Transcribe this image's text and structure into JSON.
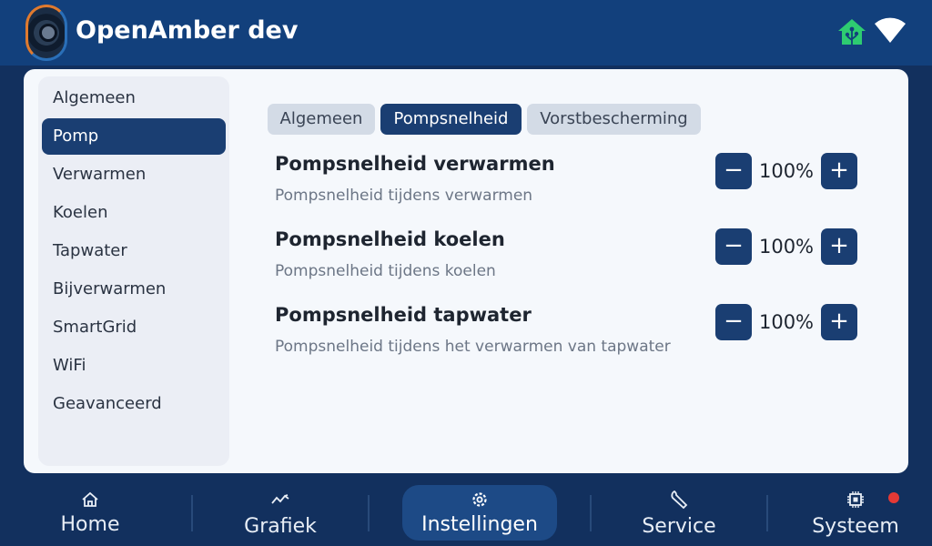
{
  "app": {
    "title": "OpenAmber dev"
  },
  "status_icons": {
    "home_assistant": "home-assistant-icon",
    "wifi": "wifi-icon",
    "home_color": "#2ecc71"
  },
  "sidebar": {
    "items": [
      {
        "label": "Algemeen"
      },
      {
        "label": "Pomp",
        "active": true
      },
      {
        "label": "Verwarmen"
      },
      {
        "label": "Koelen"
      },
      {
        "label": "Tapwater"
      },
      {
        "label": "Bijverwarmen"
      },
      {
        "label": "SmartGrid"
      },
      {
        "label": "WiFi"
      },
      {
        "label": "Geavanceerd"
      }
    ]
  },
  "tabs": [
    {
      "label": "Algemeen"
    },
    {
      "label": "Pompsnelheid",
      "active": true
    },
    {
      "label": "Vorstbescherming"
    }
  ],
  "settings": [
    {
      "title": "Pompsnelheid verwarmen",
      "description": "Pompsnelheid tijdens verwarmen",
      "value": "100%",
      "minus": "−",
      "plus": "+"
    },
    {
      "title": "Pompsnelheid koelen",
      "description": "Pompsnelheid tijdens koelen",
      "value": "100%",
      "minus": "−",
      "plus": "+"
    },
    {
      "title": "Pompsnelheid tapwater",
      "description": "Pompsnelheid tijdens het verwarmen van tapwater",
      "value": "100%",
      "minus": "−",
      "plus": "+"
    }
  ],
  "navbar": {
    "items": [
      {
        "label": "Home",
        "icon": "home-icon"
      },
      {
        "label": "Grafiek",
        "icon": "chart-icon"
      },
      {
        "label": "Instellingen",
        "icon": "gear-icon",
        "active": true
      },
      {
        "label": "Service",
        "icon": "wrench-icon"
      },
      {
        "label": "Systeem",
        "icon": "chip-icon"
      }
    ],
    "alert_color": "#e53935"
  },
  "colors": {
    "primary": "#1a3e72",
    "header": "#12407c",
    "background": "#12305e",
    "panel": "#f5f8fc"
  }
}
